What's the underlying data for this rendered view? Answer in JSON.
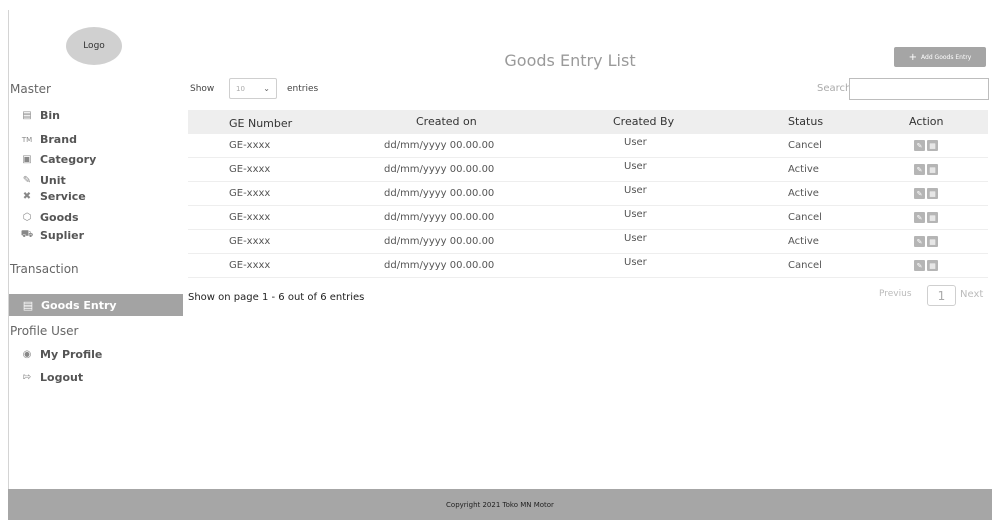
{
  "logo": {
    "text": "Logo"
  },
  "sidebar": {
    "master_title": "Master",
    "master_items": [
      {
        "label": "Bin",
        "icon": "bin-icon"
      },
      {
        "label": "Brand",
        "icon": "tm-icon"
      },
      {
        "label": "Category",
        "icon": "category-icon"
      },
      {
        "label": "Unit",
        "icon": "pencil-icon"
      },
      {
        "label": "Service",
        "icon": "tools-icon"
      },
      {
        "label": "Goods",
        "icon": "box-icon"
      },
      {
        "label": "Suplier",
        "icon": "truck-icon"
      }
    ],
    "transaction_title": "Transaction",
    "transaction_items": [
      {
        "label": "Goods Entry",
        "icon": "clipboard-icon",
        "active": true
      }
    ],
    "profile_title": "Profile User",
    "profile_items": [
      {
        "label": "My Profile",
        "icon": "user-circle-icon"
      },
      {
        "label": "Logout",
        "icon": "logout-icon"
      }
    ]
  },
  "header": {
    "title": "Goods Entry List",
    "add_button": "Add Goods Entry"
  },
  "controls": {
    "show_label": "Show",
    "show_value": "10",
    "entries_label": "entries",
    "search_label": "Search:",
    "search_value": ""
  },
  "table": {
    "columns": [
      "GE Number",
      "Created on",
      "Created By",
      "Status",
      "Action"
    ],
    "rows": [
      {
        "ge_number": "GE-xxxx",
        "created_on": "dd/mm/yyyy 00.00.00",
        "created_by": "User",
        "status": "Cancel"
      },
      {
        "ge_number": "GE-xxxx",
        "created_on": "dd/mm/yyyy 00.00.00",
        "created_by": "User",
        "status": "Active"
      },
      {
        "ge_number": "GE-xxxx",
        "created_on": "dd/mm/yyyy 00.00.00",
        "created_by": "User",
        "status": "Active"
      },
      {
        "ge_number": "GE-xxxx",
        "created_on": "dd/mm/yyyy 00.00.00",
        "created_by": "User",
        "status": "Cancel"
      },
      {
        "ge_number": "GE-xxxx",
        "created_on": "dd/mm/yyyy 00.00.00",
        "created_by": "User",
        "status": "Active"
      },
      {
        "ge_number": "GE-xxxx",
        "created_on": "dd/mm/yyyy 00.00.00",
        "created_by": "User",
        "status": "Cancel"
      }
    ]
  },
  "pagination": {
    "summary": "Show on page 1 - 6 out of 6 entries",
    "previous": "Previus",
    "current_page": "1",
    "next": "Next"
  },
  "footer": {
    "copyright": "Copyright 2021 Toko MN Motor"
  }
}
